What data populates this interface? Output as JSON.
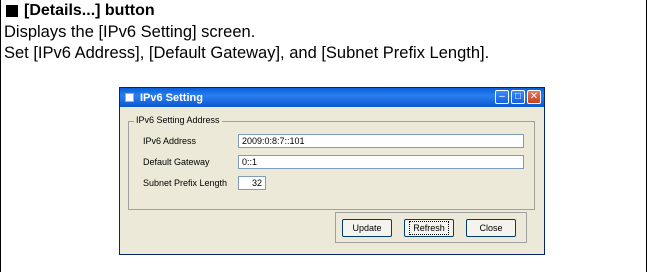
{
  "doc": {
    "heading": "[Details...] button",
    "line1": "Displays the [IPv6 Setting] screen.",
    "line2": "Set [IPv6 Address], [Default Gateway], and [Subnet Prefix Length]."
  },
  "window": {
    "title": "IPv6 Setting",
    "group_title": "IPv6 Setting Address",
    "fields": {
      "ipv6_label": "IPv6 Address",
      "ipv6_value": "2009:0:8:7::101",
      "gateway_label": "Default Gateway",
      "gateway_value": "0::1",
      "prefix_label": "Subnet Prefix Length",
      "prefix_value": "32"
    },
    "buttons": {
      "update": "Update",
      "refresh": "Refresh",
      "close": "Close"
    },
    "titlebar_icons": [
      "minimize-icon",
      "maximize-icon",
      "close-icon"
    ]
  }
}
